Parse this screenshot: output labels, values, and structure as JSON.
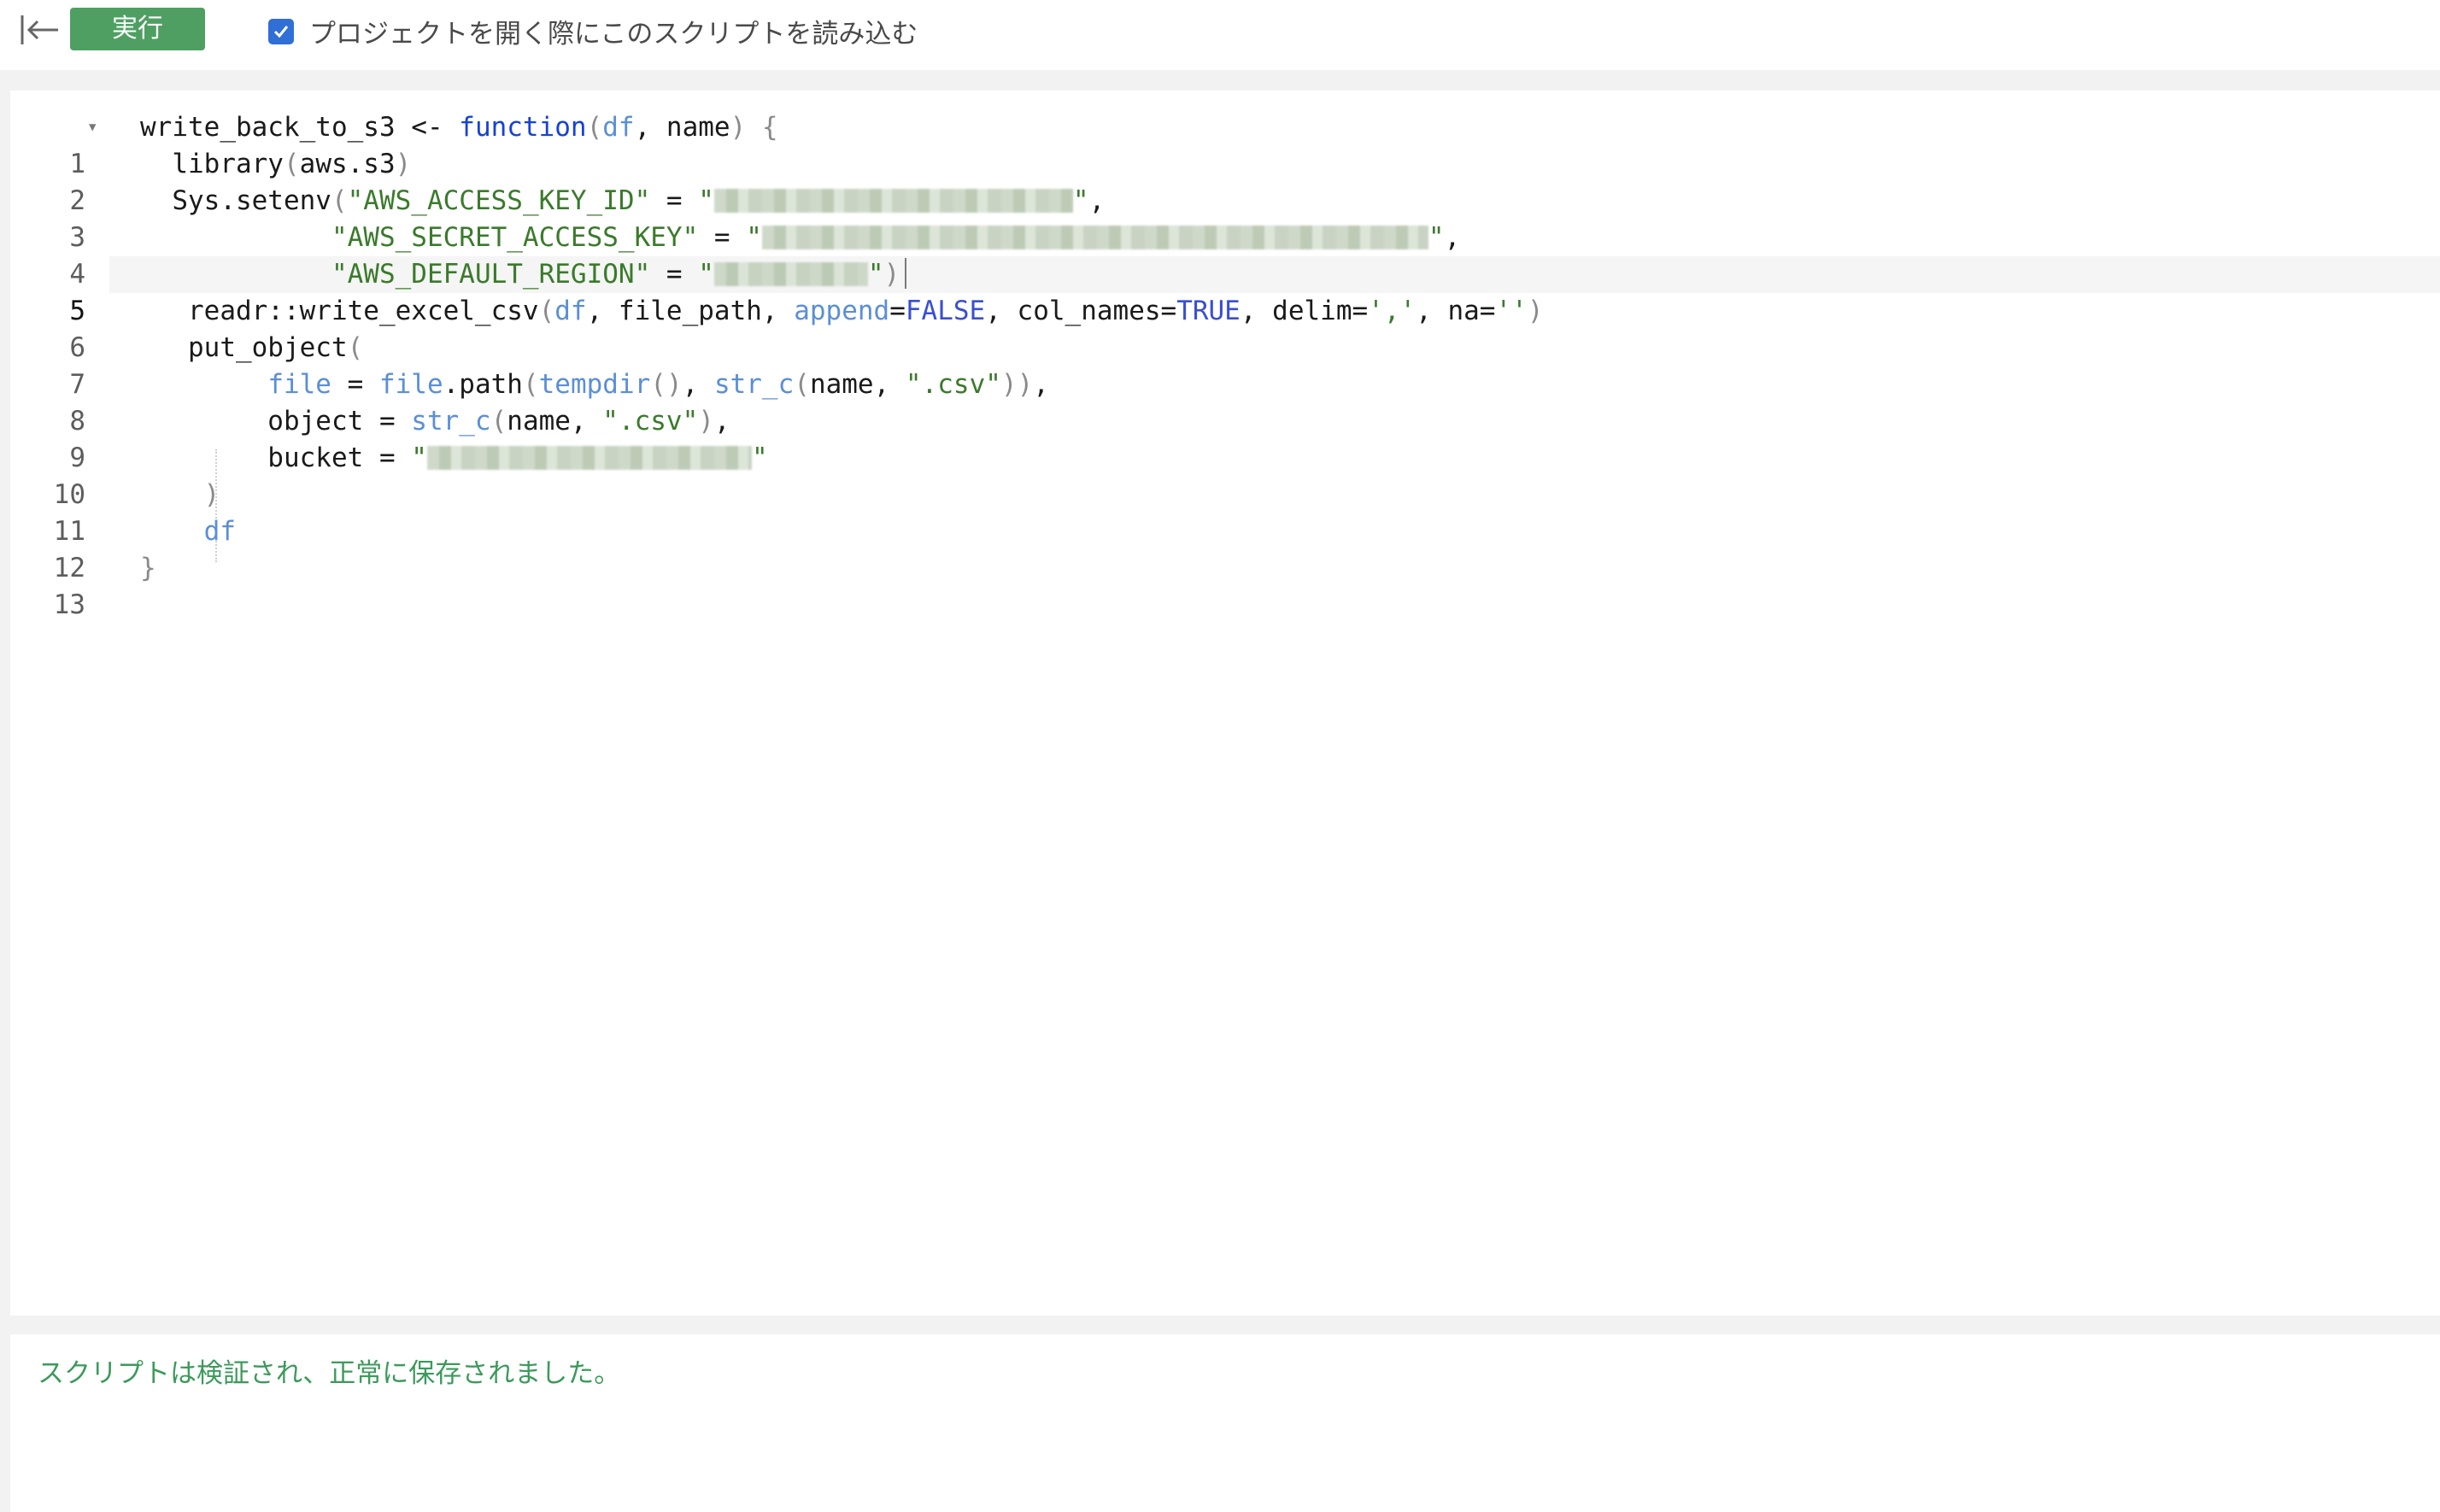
{
  "toolbar": {
    "run_label": "実行",
    "load_on_open_label": "プロジェクトを開く際にこのスクリプトを読み込む",
    "load_on_open_checked": true
  },
  "editor": {
    "active_line": 5,
    "line_numbers": [
      "1",
      "2",
      "3",
      "4",
      "5",
      "6",
      "7",
      "8",
      "9",
      "10",
      "11",
      "12",
      "13"
    ]
  },
  "status": {
    "message": "スクリプトは検証され、正常に保存されました。"
  }
}
